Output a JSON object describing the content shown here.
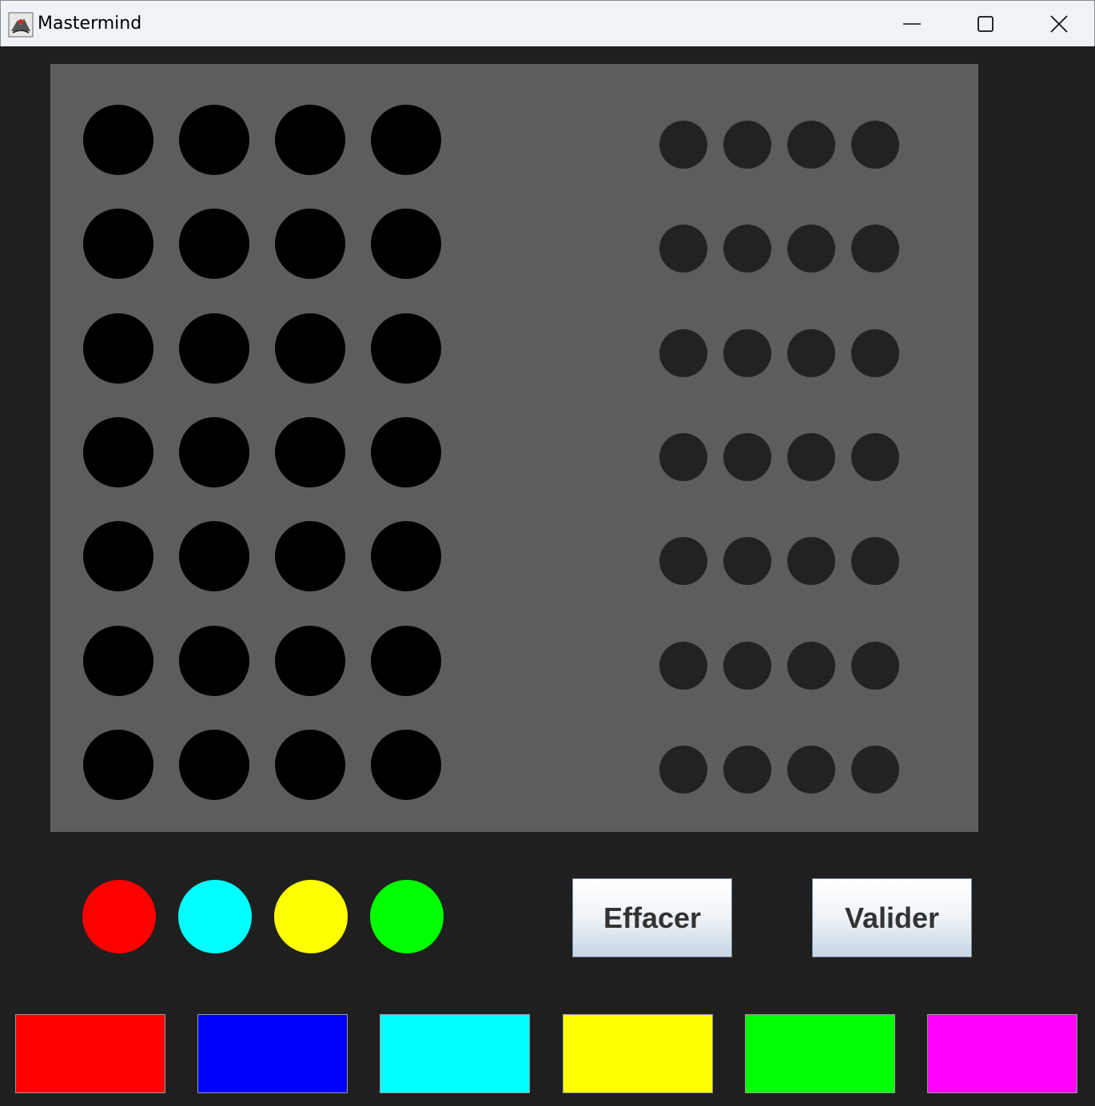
{
  "window": {
    "title": "Mastermind",
    "icon": "java-duke-icon",
    "controls": [
      "minimize-icon",
      "maximize-icon",
      "close-icon"
    ]
  },
  "board": {
    "background": "#5d5d5d",
    "rows": 7,
    "pegs_per_row": 4,
    "peg_color": "#000000",
    "hints_per_row": 4,
    "hint_color": "#222222"
  },
  "current_guess": {
    "colors": [
      "#ff0000",
      "#00ffff",
      "#ffff00",
      "#00ff00"
    ]
  },
  "buttons": {
    "clear_label": "Effacer",
    "validate_label": "Valider"
  },
  "palette": {
    "colors": [
      "#ff0000",
      "#0000ff",
      "#00ffff",
      "#ffff00",
      "#00ff00",
      "#ff00ff"
    ]
  }
}
